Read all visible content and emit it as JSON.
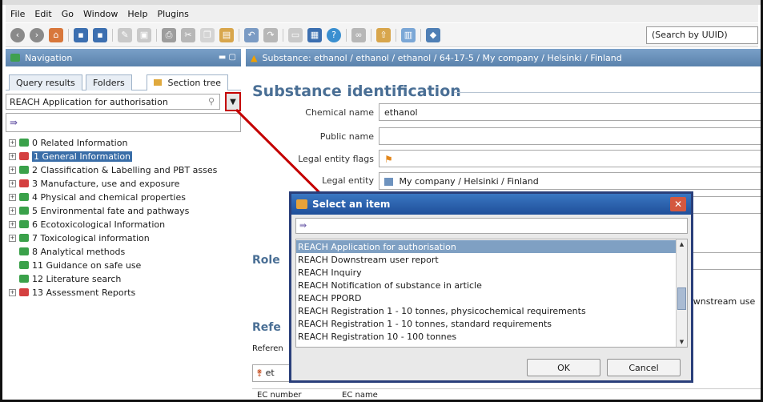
{
  "menu": {
    "items": [
      "File",
      "Edit",
      "Go",
      "Window",
      "Help",
      "Plugins"
    ]
  },
  "toolbar": {
    "search_placeholder": "(Search by UUID)"
  },
  "nav": {
    "title": "Navigation",
    "tabs": [
      "Query results",
      "Folders",
      "Section tree"
    ],
    "selected_application": "REACH Application for authorisation",
    "tree": [
      {
        "label": "0 Related Information",
        "color": "green",
        "expandable": true,
        "selected": false
      },
      {
        "label": "1 General Information",
        "color": "red",
        "expandable": true,
        "selected": true
      },
      {
        "label": "2 Classification & Labelling and PBT asses",
        "color": "green",
        "expandable": true,
        "selected": false
      },
      {
        "label": "3 Manufacture, use and exposure",
        "color": "red",
        "expandable": true,
        "selected": false
      },
      {
        "label": "4 Physical and chemical properties",
        "color": "green",
        "expandable": true,
        "selected": false
      },
      {
        "label": "5 Environmental fate and pathways",
        "color": "green",
        "expandable": true,
        "selected": false
      },
      {
        "label": "6 Ecotoxicological Information",
        "color": "green",
        "expandable": true,
        "selected": false
      },
      {
        "label": "7 Toxicological information",
        "color": "green",
        "expandable": true,
        "selected": false
      },
      {
        "label": "8 Analytical methods",
        "color": "green",
        "expandable": false,
        "selected": false
      },
      {
        "label": "11 Guidance on safe use",
        "color": "green",
        "expandable": false,
        "selected": false
      },
      {
        "label": "12 Literature search",
        "color": "green",
        "expandable": false,
        "selected": false
      },
      {
        "label": "13 Assessment Reports",
        "color": "red",
        "expandable": true,
        "selected": false
      }
    ]
  },
  "main": {
    "breadcrumb": "Substance: ethanol / ethanol / ethanol / 64-17-5 / My company / Helsinki / Finland",
    "section_title": "Substance identification",
    "fields": {
      "chemical_name_label": "Chemical name",
      "chemical_name_value": "ethanol",
      "public_name_label": "Public name",
      "legal_entity_flags_label": "Legal entity flags",
      "legal_entity_label": "Legal entity",
      "legal_entity_value": "My company / Helsinki / Finland"
    },
    "role_label": "Role",
    "downstream_partial": "ownstream use",
    "ref_title": "Refe",
    "ref_label": "Referen",
    "ref_chip": "et",
    "ec_number_header": "EC number",
    "ec_name_header": "EC name"
  },
  "dialog": {
    "title": "Select an item",
    "items": [
      "REACH Application for authorisation",
      "REACH Downstream user report",
      "REACH Inquiry",
      "REACH Notification of substance in article",
      "REACH PPORD",
      "REACH Registration 1 - 10 tonnes, physicochemical requirements",
      "REACH Registration 1 - 10 tonnes, standard requirements",
      "REACH Registration 10 - 100 tonnes"
    ],
    "selected_index": 0,
    "ok_label": "OK",
    "cancel_label": "Cancel"
  },
  "icons": {
    "back": "back-arrow-icon",
    "forward": "forward-arrow-icon",
    "home": "home-icon",
    "save": "save-icon",
    "close": "close-icon",
    "filter": "filter-icon",
    "book": "book-icon"
  },
  "colors": {
    "accent_header": "#5a82ac",
    "heading_blue": "#4a6f95",
    "selected_row": "#3a6ea8",
    "annotation_red": "#c40000"
  }
}
